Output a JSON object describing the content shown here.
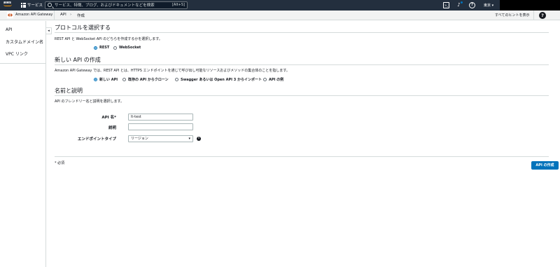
{
  "topnav": {
    "logo_text": "aws",
    "services_label": "サービス",
    "search_placeholder": "サービス、特徴、ブログ、およびドキュメントなどを検索",
    "search_shortcut": "[Alt+S]",
    "help_icon_text": "?",
    "region_label": "東京 ▾"
  },
  "subheader": {
    "service_name": "Amazon API Gateway",
    "breadcrumbs": [
      "API",
      "›",
      "作成"
    ],
    "hints_link": "すべてのヒントを表示",
    "help_icon_text": "?"
  },
  "sidebar": {
    "collapse_glyph": "◂",
    "items": [
      {
        "label": "API"
      },
      {
        "label": "カスタムドメイン名"
      },
      {
        "label": "VPC リンク"
      }
    ]
  },
  "protocol": {
    "title": "プロトコルを選択する",
    "description": "REST API と WebSocket API のどちらを作成するかを選択します。",
    "options": [
      {
        "label": "REST",
        "checked": true
      },
      {
        "label": "WebSocket",
        "checked": false
      }
    ]
  },
  "new_api": {
    "title": "新しい API の作成",
    "description": "Amazon API Gateway では、REST API とは、HTTPS エンドポイントを通じて呼び出し可能なリソースおよびメソッドの集合体のことを指します。",
    "options": [
      {
        "label": "新しい API",
        "checked": true
      },
      {
        "label": "既存の API からクローン",
        "checked": false
      },
      {
        "label": "Swagger あるいは Open API 3 からインポート",
        "checked": false
      },
      {
        "label": "API の例",
        "checked": false
      }
    ]
  },
  "name_section": {
    "title": "名前と説明",
    "description": "API のフレンドリー名と説明を選択します。",
    "api_name_label": "API 名*",
    "api_name_value": "lt-test",
    "description_label": "説明",
    "description_value": "",
    "endpoint_label": "エンドポイントタイプ",
    "endpoint_value": "リージョン",
    "info_glyph": "i"
  },
  "footer": {
    "required_note": "* 必須",
    "create_button": "API の作成"
  },
  "colors": {
    "nav_bg": "#232f3e",
    "primary": "#0073bb",
    "aws_orange": "#ff9900"
  }
}
